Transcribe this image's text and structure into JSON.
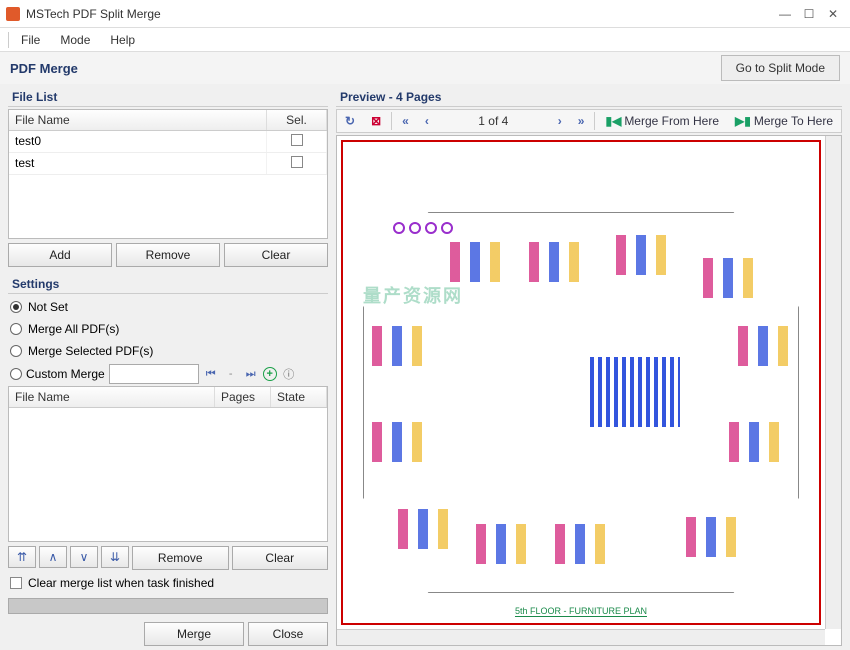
{
  "titlebar": {
    "title": "MSTech PDF Split Merge"
  },
  "menubar": {
    "file": "File",
    "mode": "Mode",
    "help": "Help"
  },
  "section": {
    "title": "PDF Merge",
    "split_btn": "Go to Split Mode"
  },
  "filelist": {
    "header": "File List",
    "col_name": "File Name",
    "col_sel": "Sel.",
    "rows": [
      {
        "name": "test0",
        "sel": false
      },
      {
        "name": "test",
        "sel": false
      }
    ],
    "add": "Add",
    "remove": "Remove",
    "clear": "Clear"
  },
  "settings": {
    "header": "Settings",
    "not_set": "Not Set",
    "merge_all": "Merge All PDF(s)",
    "merge_selected": "Merge Selected PDF(s)",
    "custom": "Custom Merge",
    "custom_value": ""
  },
  "mergelist": {
    "col_name": "File Name",
    "col_pages": "Pages",
    "col_state": "State",
    "remove": "Remove",
    "clear": "Clear",
    "clear_check": "Clear merge list when task finished"
  },
  "footer": {
    "merge": "Merge",
    "close": "Close"
  },
  "preview": {
    "header": "Preview - 4 Pages",
    "page_info": "1 of 4",
    "merge_from": "Merge From Here",
    "merge_to": "Merge To Here",
    "floor_label": "5th FLOOR - FURNITURE PLAN",
    "watermark": "量产资源网"
  }
}
